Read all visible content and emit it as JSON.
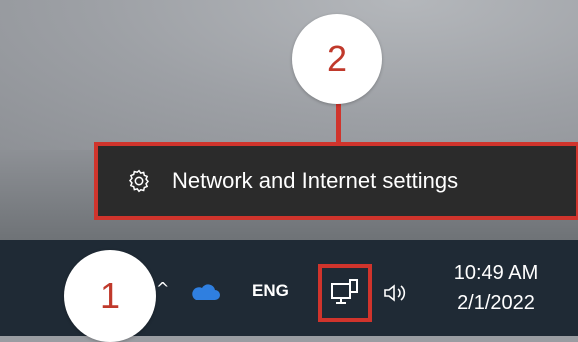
{
  "callouts": {
    "first": "1",
    "second": "2"
  },
  "context_menu": {
    "items": [
      {
        "label": "Network and Internet settings",
        "icon": "gear-icon"
      }
    ]
  },
  "taskbar": {
    "tray": {
      "chevron": "^",
      "onedrive_icon": "onedrive-icon",
      "language": "ENG",
      "network_icon": "network-icon",
      "volume_icon": "volume-icon"
    },
    "clock": {
      "time": "10:49 AM",
      "date": "2/1/2022"
    }
  },
  "colors": {
    "annotation_red": "#d0342c",
    "menu_bg": "#2b2b2b",
    "taskbar_bg": "#1f2a35"
  }
}
